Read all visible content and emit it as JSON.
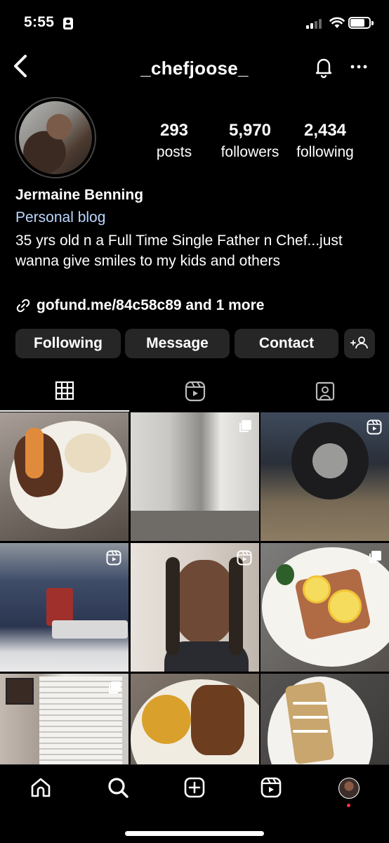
{
  "status_bar": {
    "time": "5:55",
    "battery_level": 0.75
  },
  "header": {
    "username": "_chefjoose_",
    "icons": [
      "back-icon",
      "bell-icon",
      "more-icon"
    ]
  },
  "profile": {
    "stats": [
      {
        "value": "293",
        "label": "posts"
      },
      {
        "value": "5,970",
        "label": "followers"
      },
      {
        "value": "2,434",
        "label": "following"
      }
    ],
    "full_name": "Jermaine Benning",
    "category": "Personal blog",
    "bio": "35 yrs old n a Full Time Single Father n Chef...just wanna give smiles to my kids and others",
    "link": "gofund.me/84c58c89 and 1 more",
    "link_color": "#bcd8ff"
  },
  "actions": {
    "following": "Following",
    "message": "Message",
    "contact": "Contact"
  },
  "tabs": [
    "grid-icon",
    "reels-icon",
    "tagged-icon"
  ],
  "grid": [
    {
      "subject": "steak with shrimp and onion",
      "badge": ""
    },
    {
      "subject": "broken door",
      "badge": "carousel"
    },
    {
      "subject": "truck tire",
      "badge": "reel"
    },
    {
      "subject": "truck rear",
      "badge": "reel"
    },
    {
      "subject": "selfie",
      "badge": "reel"
    },
    {
      "subject": "salmon with lemon",
      "badge": "carousel"
    },
    {
      "subject": "window blinds",
      "badge": "carousel"
    },
    {
      "subject": "chickpeas and fish",
      "badge": ""
    },
    {
      "subject": "fish with sauce",
      "badge": ""
    }
  ],
  "bottom_nav": [
    "home-icon",
    "search-icon",
    "create-icon",
    "reels-icon",
    "profile-avatar"
  ]
}
